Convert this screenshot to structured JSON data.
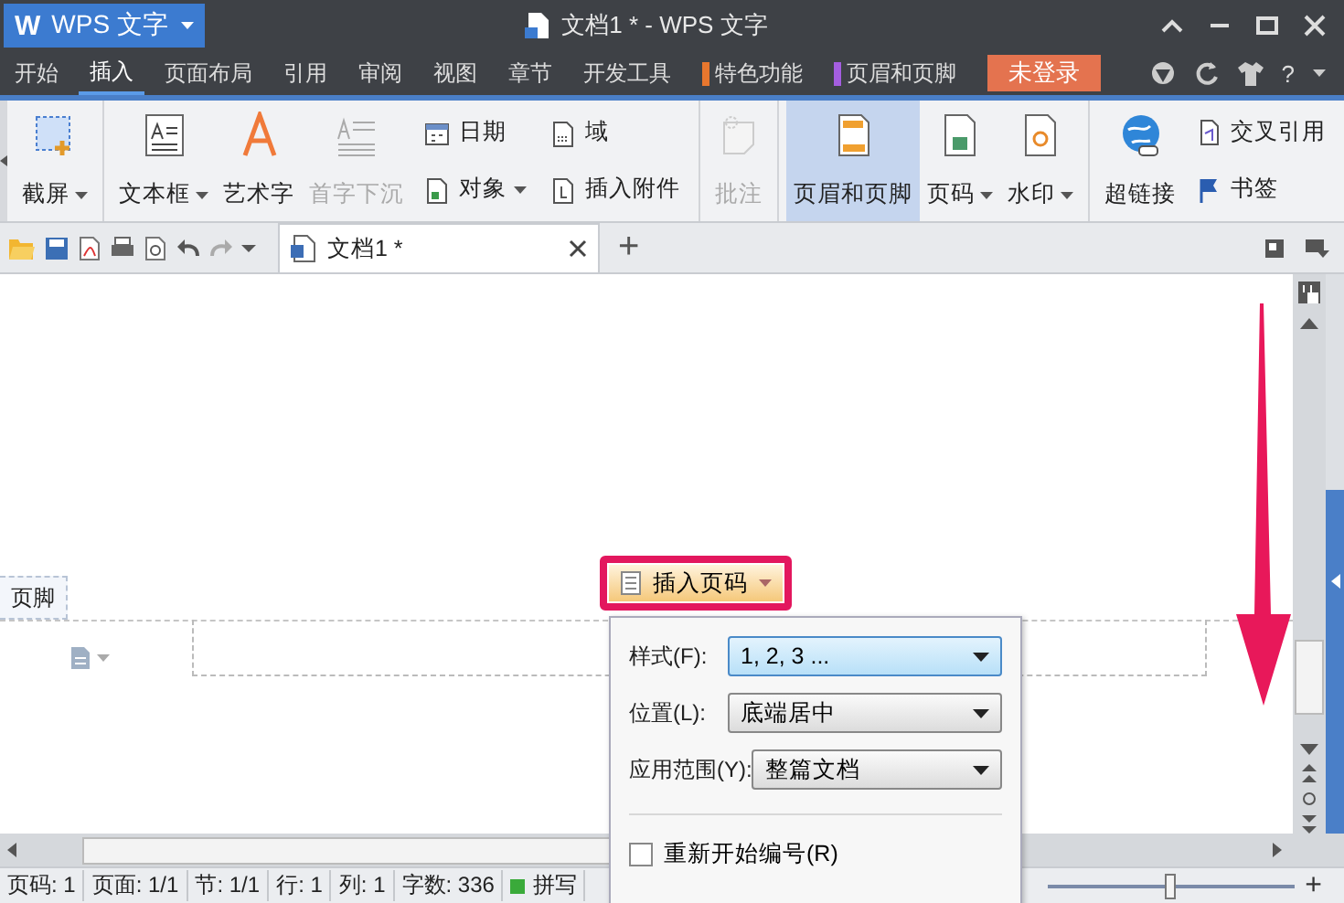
{
  "window": {
    "logo": "W",
    "app_menu": "WPS 文字",
    "title": "文档1 * - WPS 文字"
  },
  "menu_tabs": [
    {
      "label": "开始",
      "selected": false
    },
    {
      "label": "插入",
      "selected": true
    },
    {
      "label": "页面布局",
      "selected": false
    },
    {
      "label": "引用",
      "selected": false
    },
    {
      "label": "审阅",
      "selected": false
    },
    {
      "label": "视图",
      "selected": false
    },
    {
      "label": "章节",
      "selected": false
    },
    {
      "label": "开发工具",
      "selected": false
    },
    {
      "label": "特色功能",
      "selected": false,
      "color": "#e8772e"
    },
    {
      "label": "页眉和页脚",
      "selected": false,
      "color": "#a45ee0"
    }
  ],
  "login_button": "未登录",
  "help_label": "?",
  "ribbon": {
    "groups": [
      {
        "items": [
          {
            "kind": "large",
            "label": "截屏",
            "dropdown": true,
            "disabled": false,
            "selected": false
          }
        ]
      },
      {
        "items": [
          {
            "kind": "large",
            "label": "文本框",
            "dropdown": true,
            "disabled": false,
            "selected": false
          },
          {
            "kind": "large",
            "label": "艺术字",
            "dropdown": false,
            "disabled": false,
            "selected": false
          },
          {
            "kind": "large",
            "label": "首字下沉",
            "dropdown": false,
            "disabled": true,
            "selected": false
          },
          {
            "kind": "small",
            "label": "日期",
            "dropdown": false,
            "disabled": false,
            "selected": false
          },
          {
            "kind": "small",
            "label": "对象",
            "dropdown": true,
            "disabled": false,
            "selected": false
          },
          {
            "kind": "small",
            "label": "域",
            "dropdown": false,
            "disabled": false,
            "selected": false
          },
          {
            "kind": "small",
            "label": "插入附件",
            "dropdown": false,
            "disabled": false,
            "selected": false
          }
        ]
      },
      {
        "items": [
          {
            "kind": "large",
            "label": "批注",
            "dropdown": false,
            "disabled": true,
            "selected": false
          }
        ]
      },
      {
        "items": [
          {
            "kind": "large",
            "label": "页眉和页脚",
            "dropdown": false,
            "disabled": false,
            "selected": true
          },
          {
            "kind": "large",
            "label": "页码",
            "dropdown": true,
            "disabled": false,
            "selected": false
          },
          {
            "kind": "large",
            "label": "水印",
            "dropdown": true,
            "disabled": false,
            "selected": false
          }
        ]
      },
      {
        "items": [
          {
            "kind": "large",
            "label": "超链接",
            "dropdown": false,
            "disabled": false,
            "selected": false
          },
          {
            "kind": "small",
            "label": "交叉引用",
            "dropdown": false,
            "disabled": false,
            "selected": false
          },
          {
            "kind": "small",
            "label": "书签",
            "dropdown": false,
            "disabled": false,
            "selected": false
          }
        ]
      }
    ]
  },
  "document_tab": {
    "label": "文档1 *",
    "add": "+"
  },
  "footer_label": "页脚",
  "insert_page_number_button": "插入页码",
  "popup": {
    "fields": [
      {
        "label": "样式(F):",
        "value": "1, 2, 3 ...",
        "highlighted": true
      },
      {
        "label": "位置(L):",
        "value": "底端居中",
        "highlighted": false
      },
      {
        "label": "应用范围(Y):",
        "value": "整篇文档",
        "highlighted": false
      }
    ],
    "restart_numbering": {
      "label": "重新开始编号(R)",
      "checked": false
    }
  },
  "status_bar": [
    {
      "text": "页码: 1"
    },
    {
      "text": "页面: 1/1"
    },
    {
      "text": "节: 1/1"
    },
    {
      "text": "行: 1"
    },
    {
      "text": "列: 1"
    },
    {
      "text": "字数: 336"
    },
    {
      "text": "拼写"
    }
  ],
  "zoom_slider": {
    "plus": "+",
    "level": 0.5
  }
}
